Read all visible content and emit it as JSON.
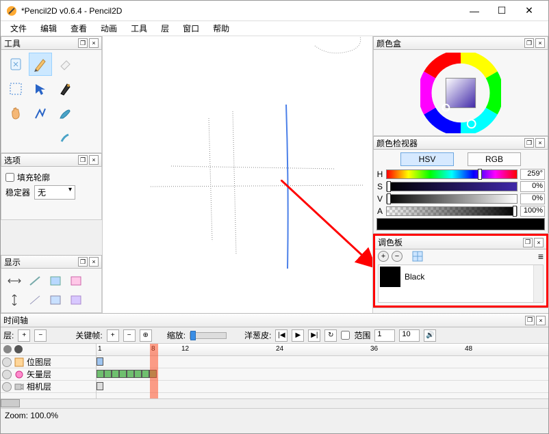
{
  "window": {
    "title": "*Pencil2D v0.6.4 - Pencil2D"
  },
  "menu": {
    "file": "文件",
    "edit": "编辑",
    "view": "查看",
    "anim": "动画",
    "tools": "工具",
    "layer": "层",
    "window": "窗口",
    "help": "帮助"
  },
  "panels": {
    "tools": "工具",
    "options": "选项",
    "display": "显示",
    "colorbox": "颜色盒",
    "inspector": "颜色检视器",
    "palette": "调色板",
    "timeline": "时间轴"
  },
  "options_panel": {
    "fill_outline": "填充轮廓",
    "stabilizer": "稳定器",
    "stabilizer_value": "无"
  },
  "inspector": {
    "tab_hsv": "HSV",
    "tab_rgb": "RGB",
    "h": {
      "label": "H",
      "value": "259°"
    },
    "s": {
      "label": "S",
      "value": "0%"
    },
    "v": {
      "label": "V",
      "value": "0%"
    },
    "a": {
      "label": "A",
      "value": "100%"
    }
  },
  "palette": {
    "items": [
      {
        "name": "Black",
        "color": "#000000"
      }
    ]
  },
  "timeline": {
    "layers_label": "层:",
    "keyframes": "关键帧:",
    "zoom": "缩放:",
    "onion": "洋葱皮:",
    "range": "范围",
    "range_start": "1",
    "range_end": "10",
    "layers": [
      {
        "name": "位图层"
      },
      {
        "name": "矢量层"
      },
      {
        "name": "相机层"
      }
    ],
    "ruler": {
      "marks": [
        "1",
        "8",
        "12",
        "24",
        "36",
        "48"
      ]
    }
  },
  "status": {
    "zoom": "Zoom: 100.0%"
  }
}
